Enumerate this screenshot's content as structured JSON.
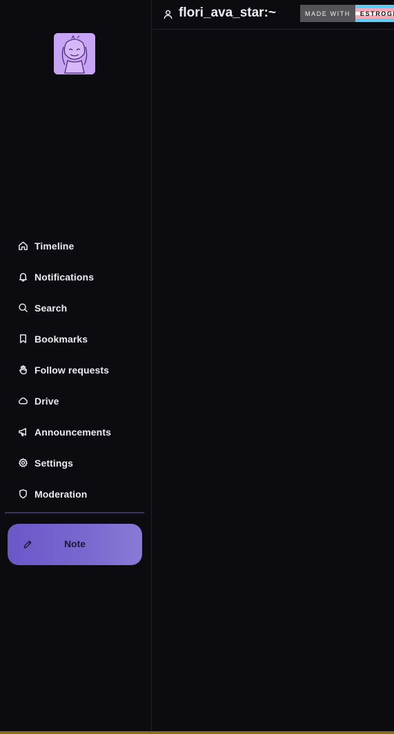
{
  "header": {
    "title": "flori_ava_star:~",
    "badge": {
      "left_text": "MADE WITH",
      "right_text": "ESTROGEN"
    }
  },
  "avatar": {
    "alt": "avatar"
  },
  "nav": {
    "items": [
      {
        "label": "Timeline",
        "icon": "home-icon"
      },
      {
        "label": "Notifications",
        "icon": "bell-icon"
      },
      {
        "label": "Search",
        "icon": "search-icon"
      },
      {
        "label": "Bookmarks",
        "icon": "bookmark-icon"
      },
      {
        "label": "Follow requests",
        "icon": "hand-icon"
      },
      {
        "label": "Drive",
        "icon": "cloud-icon"
      },
      {
        "label": "Announcements",
        "icon": "megaphone-icon"
      },
      {
        "label": "Settings",
        "icon": "gear-icon"
      },
      {
        "label": "Moderation",
        "icon": "shield-icon"
      }
    ]
  },
  "compose": {
    "label": "Note",
    "icon": "pencil-icon"
  },
  "colors": {
    "background": "#0c0b10",
    "accent": "#6b57c9",
    "avatar_bg": "#c8a4f5"
  }
}
